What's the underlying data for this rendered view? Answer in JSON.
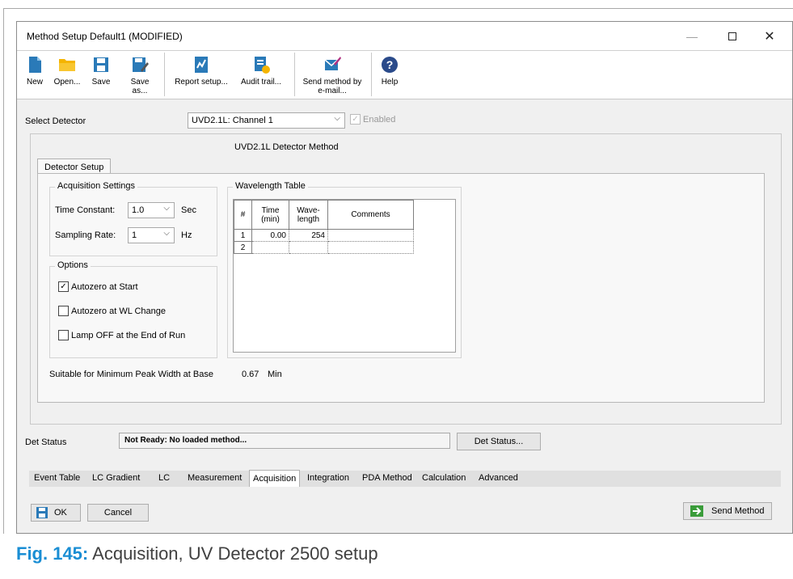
{
  "window": {
    "title": "Method Setup Default1 (MODIFIED)",
    "controls": [
      "—",
      "☐",
      "✕"
    ]
  },
  "toolbar": {
    "new": "New",
    "open": "Open...",
    "save": "Save",
    "save_as": "Save as...",
    "report_setup": "Report setup...",
    "audit_trail": "Audit trail...",
    "send_method_line1": "Send method by",
    "send_method_line2": "e-mail...",
    "help": "Help"
  },
  "detector_select": {
    "label": "Select Detector",
    "value": "UVD2.1L: Channel 1",
    "enabled_label": "Enabled",
    "enabled_checked": true
  },
  "method": {
    "heading": "UVD2.1L Detector Method",
    "tab": "Detector Setup",
    "acquisition_group": "Acquisition Settings",
    "time_constant_label": "Time Constant:",
    "time_constant_value": "1.0",
    "time_constant_unit": "Sec",
    "sampling_rate_label": "Sampling Rate:",
    "sampling_rate_value": "1",
    "sampling_rate_unit": "Hz",
    "options_group": "Options",
    "options": [
      {
        "label": "Autozero at Start",
        "checked": true
      },
      {
        "label": "Autozero at WL Change",
        "checked": false
      },
      {
        "label": "Lamp OFF at the End of Run",
        "checked": false
      }
    ],
    "wavelength_group": "Wavelength Table",
    "table_headers": {
      "num": "#",
      "time_line1": "Time",
      "time_line2": "(min)",
      "wave_line1": "Wave-",
      "wave_line2": "length",
      "comments": "Comments"
    },
    "table_rows": [
      {
        "num": "1",
        "time": "0.00",
        "wave": "254",
        "comments": ""
      },
      {
        "num": "2",
        "time": "",
        "wave": "",
        "comments": ""
      }
    ],
    "peak_width_label": "Suitable for Minimum Peak Width at Base",
    "peak_width_value": "0.67",
    "peak_width_unit": "Min"
  },
  "det_status": {
    "label": "Det Status",
    "value": "Not Ready: No loaded method...",
    "button": "Det Status..."
  },
  "bottom_tabs": [
    "Event Table",
    "LC Gradient",
    "LC",
    "Measurement",
    "Acquisition",
    "Integration",
    "PDA Method",
    "Calculation",
    "Advanced"
  ],
  "active_bottom_tab": "Acquisition",
  "footer": {
    "ok": "OK",
    "cancel": "Cancel",
    "send_method": "Send Method"
  },
  "caption": {
    "fig": "Fig. 145:",
    "text": "Acquisition, UV Detector 2500 setup"
  },
  "colors": {
    "accent_blue": "#1a8ed4",
    "icon_blue": "#2a7ab8",
    "icon_yellow": "#f4b400",
    "icon_green": "#3a9c3a"
  }
}
